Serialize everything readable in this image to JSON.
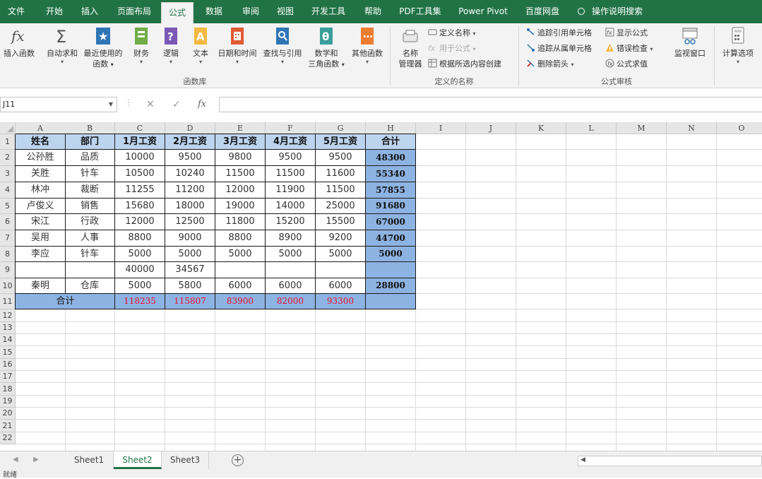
{
  "menu": {
    "tabs": [
      "文件",
      "开始",
      "插入",
      "页面布局",
      "公式",
      "数据",
      "审阅",
      "视图",
      "开发工具",
      "帮助",
      "PDF工具集",
      "Power Pivot",
      "百度网盘"
    ],
    "active": "公式",
    "tell_me": "操作说明搜索"
  },
  "ribbon": {
    "function_library": {
      "label": "函数库",
      "insert_function": "插入函数",
      "autosum": "自动求和",
      "recently_used_1": "最近使用的",
      "recently_used_2": "函数",
      "financial": "财务",
      "logical": "逻辑",
      "text": "文本",
      "date_time": "日期和时间",
      "lookup": "查找与引用",
      "math_1": "数学和",
      "math_2": "三角函数",
      "more": "其他函数"
    },
    "defined_names": {
      "label": "定义的名称",
      "name_manager_1": "名称",
      "name_manager_2": "管理器",
      "define_name": "定义名称",
      "use_in_formula": "用于公式",
      "create_from_selection": "根据所选内容创建"
    },
    "formula_auditing": {
      "label": "公式审核",
      "trace_precedents": "追踪引用单元格",
      "trace_dependents": "追踪从属单元格",
      "remove_arrows": "删除箭头",
      "show_formulas": "显示公式",
      "error_checking": "错误检查",
      "evaluate_formula": "公式求值",
      "watch_window": "监视窗口"
    },
    "calculation": {
      "calc_options": "计算选项"
    }
  },
  "formula_bar": {
    "name_box": "J11",
    "fx": "fx",
    "cancel": "✕",
    "enter": "✓",
    "formula": ""
  },
  "grid": {
    "columns": [
      "A",
      "B",
      "C",
      "D",
      "E",
      "F",
      "G",
      "H",
      "I",
      "J",
      "K",
      "L",
      "M",
      "N",
      "O"
    ],
    "rows": [
      "1",
      "2",
      "3",
      "4",
      "5",
      "6",
      "7",
      "8",
      "9",
      "10",
      "11",
      "12",
      "13",
      "14",
      "15",
      "16",
      "17",
      "18",
      "19",
      "20",
      "21",
      "22"
    ],
    "header": [
      "姓名",
      "部门",
      "1月工资",
      "2月工资",
      "3月工资",
      "4月工资",
      "5月工资",
      "合计"
    ],
    "data": [
      [
        "公孙胜",
        "品质",
        "10000",
        "9500",
        "9800",
        "9500",
        "9500",
        "48300"
      ],
      [
        "关胜",
        "针车",
        "10500",
        "10240",
        "11500",
        "11500",
        "11600",
        "55340"
      ],
      [
        "林冲",
        "裁断",
        "11255",
        "11200",
        "12000",
        "11900",
        "11500",
        "57855"
      ],
      [
        "卢俊义",
        "销售",
        "15680",
        "18000",
        "19000",
        "14000",
        "25000",
        "91680"
      ],
      [
        "宋江",
        "行政",
        "12000",
        "12500",
        "11800",
        "15200",
        "15500",
        "67000"
      ],
      [
        "吴用",
        "人事",
        "8800",
        "9000",
        "8800",
        "8900",
        "9200",
        "44700"
      ],
      [
        "李应",
        "针车",
        "5000",
        "5000",
        "5000",
        "5000",
        "5000",
        "5000"
      ],
      [
        "",
        "",
        "40000",
        "34567",
        "",
        "",
        "",
        ""
      ],
      [
        "秦明",
        "仓库",
        "5000",
        "5800",
        "6000",
        "6000",
        "6000",
        "28800"
      ]
    ],
    "total_label": "合计",
    "totals": [
      "118235",
      "115807",
      "83900",
      "82000",
      "93300",
      ""
    ]
  },
  "sheets": {
    "tabs": [
      "Sheet1",
      "Sheet2",
      "Sheet3"
    ],
    "active": "Sheet2",
    "add": "+"
  },
  "status": {
    "text": "就绪"
  },
  "colors": {
    "accent": "#217346",
    "header_fill": "#bcd4ee",
    "total_fill": "#8db3e2",
    "total_text": "#e8102b"
  }
}
